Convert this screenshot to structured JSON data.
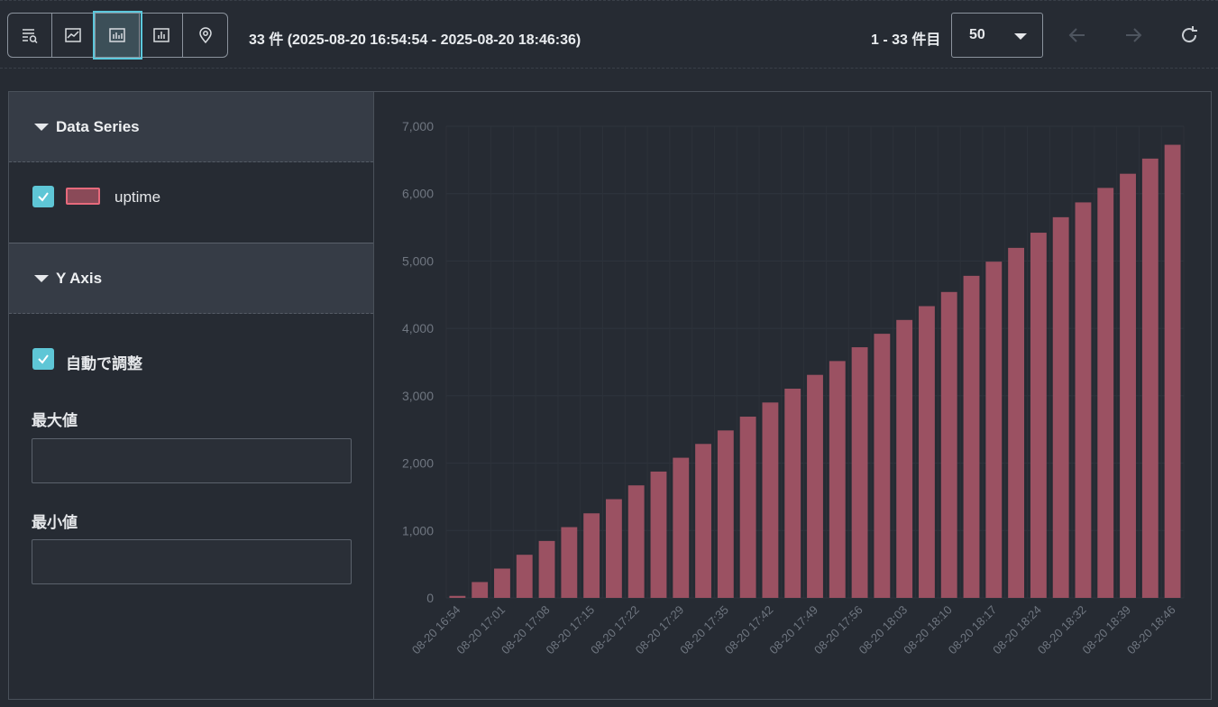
{
  "toolbar": {
    "view_buttons": [
      {
        "name": "table-search-icon"
      },
      {
        "name": "line-chart-icon"
      },
      {
        "name": "bar-chart-icon",
        "active": true
      },
      {
        "name": "column-chart-icon"
      },
      {
        "name": "map-pin-icon"
      }
    ],
    "result_summary": "33 件 (2025-08-20 16:54:54 - 2025-08-20 18:46:36)",
    "range_label": "1 - 33 件目",
    "page_size": "50",
    "icons": {
      "prev": "arrow-left-icon",
      "next": "arrow-right-icon",
      "refresh": "refresh-icon"
    }
  },
  "panel": {
    "data_series": {
      "title": "Data Series",
      "items": [
        {
          "label": "uptime",
          "checked": true,
          "color": "#e66a7c"
        }
      ]
    },
    "y_axis": {
      "title": "Y Axis",
      "autoscale_label": "自動で調整",
      "autoscale_checked": true,
      "max_label": "最大値",
      "max_value": "",
      "min_label": "最小値",
      "min_value": ""
    }
  },
  "colors": {
    "accent": "#5ec6d6",
    "bar": "#9b5162",
    "background": "#262b33"
  },
  "chart_data": {
    "type": "bar",
    "series": [
      {
        "name": "uptime",
        "values": [
          30,
          235,
          435,
          640,
          845,
          1050,
          1255,
          1465,
          1670,
          1875,
          2080,
          2285,
          2485,
          2690,
          2900,
          3105,
          3310,
          3515,
          3720,
          3920,
          4125,
          4330,
          4540,
          4780,
          4990,
          5195,
          5420,
          5650,
          5870,
          6085,
          6295,
          6520,
          6725
        ]
      }
    ],
    "x_tick_labels": [
      "08-20 16:54",
      "08-20 17:01",
      "08-20 17:08",
      "08-20 17:15",
      "08-20 17:22",
      "08-20 17:29",
      "08-20 17:35",
      "08-20 17:42",
      "08-20 17:49",
      "08-20 17:56",
      "08-20 18:03",
      "08-20 18:10",
      "08-20 18:17",
      "08-20 18:24",
      "08-20 18:32",
      "08-20 18:39",
      "08-20 18:46"
    ],
    "y_ticks": [
      "0",
      "1,000",
      "2,000",
      "3,000",
      "4,000",
      "5,000",
      "6,000",
      "7,000"
    ],
    "ylim": [
      0,
      7000
    ],
    "grid": true
  }
}
